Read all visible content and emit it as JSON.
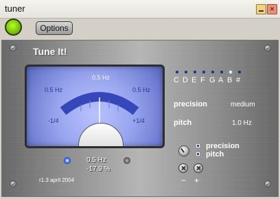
{
  "window": {
    "title": "tuner"
  },
  "toolbar": {
    "options_label": "Options",
    "status_color": "#8ee315"
  },
  "panel": {
    "title": "Tune It!",
    "meter": {
      "top_value": "0.5 Hz",
      "left_value": "0.5 Hz",
      "right_value": "0.5 Hz",
      "left_fraction": "-1/4",
      "right_fraction": "+1/4",
      "needle_offset": 0.0
    },
    "readout": {
      "frequency": "0.5 Hz",
      "percent": "-17.9 %"
    },
    "version": "r1.3 april 2004",
    "notes": [
      "C",
      "D",
      "E",
      "F",
      "G",
      "A",
      "B",
      "#"
    ],
    "active_note_index": 6,
    "precision_label": "precision",
    "precision_value": "medium",
    "pitch_label": "pitch",
    "pitch_value": "1.0 Hz",
    "mode_options": [
      "precision",
      "pitch"
    ],
    "minus_label": "−",
    "plus_label": "+"
  }
}
